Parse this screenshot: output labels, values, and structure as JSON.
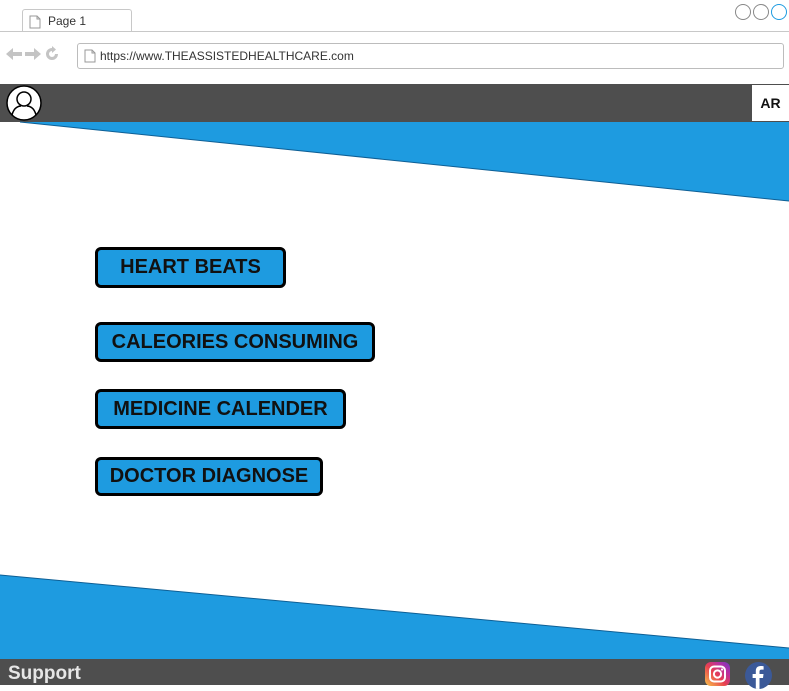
{
  "browser": {
    "tab_label": "Page 1",
    "url": "https://www.THEASSISTEDHEALTHCARE.com"
  },
  "header": {
    "language_button": "AR"
  },
  "menu": {
    "items": [
      {
        "label": "HEART BEATS"
      },
      {
        "label": "CALEORIES CONSUMING"
      },
      {
        "label": "MEDICINE CALENDER"
      },
      {
        "label": "DOCTOR DIAGNOSE"
      }
    ]
  },
  "footer": {
    "support_label": "Support",
    "social": [
      "instagram-icon",
      "facebook-icon"
    ]
  },
  "colors": {
    "accent": "#1e9be0",
    "header_bg": "#4e4e4e",
    "footer_bg": "#4e4e4e"
  }
}
